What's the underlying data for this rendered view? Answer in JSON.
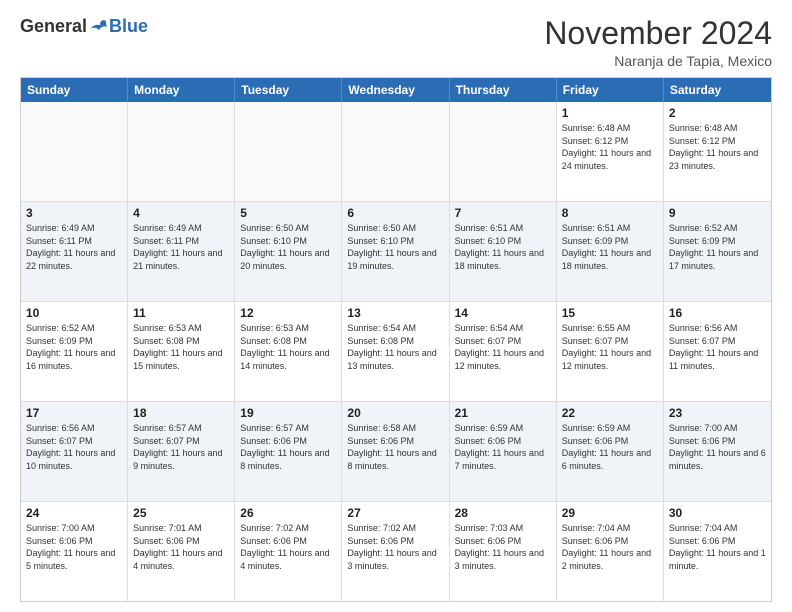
{
  "logo": {
    "general": "General",
    "blue": "Blue"
  },
  "title": "November 2024",
  "location": "Naranja de Tapia, Mexico",
  "header_days": [
    "Sunday",
    "Monday",
    "Tuesday",
    "Wednesday",
    "Thursday",
    "Friday",
    "Saturday"
  ],
  "rows": [
    [
      {
        "day": "",
        "info": "",
        "empty": true
      },
      {
        "day": "",
        "info": "",
        "empty": true
      },
      {
        "day": "",
        "info": "",
        "empty": true
      },
      {
        "day": "",
        "info": "",
        "empty": true
      },
      {
        "day": "",
        "info": "",
        "empty": true
      },
      {
        "day": "1",
        "info": "Sunrise: 6:48 AM\nSunset: 6:12 PM\nDaylight: 11 hours and 24 minutes.",
        "empty": false
      },
      {
        "day": "2",
        "info": "Sunrise: 6:48 AM\nSunset: 6:12 PM\nDaylight: 11 hours and 23 minutes.",
        "empty": false
      }
    ],
    [
      {
        "day": "3",
        "info": "Sunrise: 6:49 AM\nSunset: 6:11 PM\nDaylight: 11 hours and 22 minutes.",
        "empty": false
      },
      {
        "day": "4",
        "info": "Sunrise: 6:49 AM\nSunset: 6:11 PM\nDaylight: 11 hours and 21 minutes.",
        "empty": false
      },
      {
        "day": "5",
        "info": "Sunrise: 6:50 AM\nSunset: 6:10 PM\nDaylight: 11 hours and 20 minutes.",
        "empty": false
      },
      {
        "day": "6",
        "info": "Sunrise: 6:50 AM\nSunset: 6:10 PM\nDaylight: 11 hours and 19 minutes.",
        "empty": false
      },
      {
        "day": "7",
        "info": "Sunrise: 6:51 AM\nSunset: 6:10 PM\nDaylight: 11 hours and 18 minutes.",
        "empty": false
      },
      {
        "day": "8",
        "info": "Sunrise: 6:51 AM\nSunset: 6:09 PM\nDaylight: 11 hours and 18 minutes.",
        "empty": false
      },
      {
        "day": "9",
        "info": "Sunrise: 6:52 AM\nSunset: 6:09 PM\nDaylight: 11 hours and 17 minutes.",
        "empty": false
      }
    ],
    [
      {
        "day": "10",
        "info": "Sunrise: 6:52 AM\nSunset: 6:09 PM\nDaylight: 11 hours and 16 minutes.",
        "empty": false
      },
      {
        "day": "11",
        "info": "Sunrise: 6:53 AM\nSunset: 6:08 PM\nDaylight: 11 hours and 15 minutes.",
        "empty": false
      },
      {
        "day": "12",
        "info": "Sunrise: 6:53 AM\nSunset: 6:08 PM\nDaylight: 11 hours and 14 minutes.",
        "empty": false
      },
      {
        "day": "13",
        "info": "Sunrise: 6:54 AM\nSunset: 6:08 PM\nDaylight: 11 hours and 13 minutes.",
        "empty": false
      },
      {
        "day": "14",
        "info": "Sunrise: 6:54 AM\nSunset: 6:07 PM\nDaylight: 11 hours and 12 minutes.",
        "empty": false
      },
      {
        "day": "15",
        "info": "Sunrise: 6:55 AM\nSunset: 6:07 PM\nDaylight: 11 hours and 12 minutes.",
        "empty": false
      },
      {
        "day": "16",
        "info": "Sunrise: 6:56 AM\nSunset: 6:07 PM\nDaylight: 11 hours and 11 minutes.",
        "empty": false
      }
    ],
    [
      {
        "day": "17",
        "info": "Sunrise: 6:56 AM\nSunset: 6:07 PM\nDaylight: 11 hours and 10 minutes.",
        "empty": false
      },
      {
        "day": "18",
        "info": "Sunrise: 6:57 AM\nSunset: 6:07 PM\nDaylight: 11 hours and 9 minutes.",
        "empty": false
      },
      {
        "day": "19",
        "info": "Sunrise: 6:57 AM\nSunset: 6:06 PM\nDaylight: 11 hours and 8 minutes.",
        "empty": false
      },
      {
        "day": "20",
        "info": "Sunrise: 6:58 AM\nSunset: 6:06 PM\nDaylight: 11 hours and 8 minutes.",
        "empty": false
      },
      {
        "day": "21",
        "info": "Sunrise: 6:59 AM\nSunset: 6:06 PM\nDaylight: 11 hours and 7 minutes.",
        "empty": false
      },
      {
        "day": "22",
        "info": "Sunrise: 6:59 AM\nSunset: 6:06 PM\nDaylight: 11 hours and 6 minutes.",
        "empty": false
      },
      {
        "day": "23",
        "info": "Sunrise: 7:00 AM\nSunset: 6:06 PM\nDaylight: 11 hours and 6 minutes.",
        "empty": false
      }
    ],
    [
      {
        "day": "24",
        "info": "Sunrise: 7:00 AM\nSunset: 6:06 PM\nDaylight: 11 hours and 5 minutes.",
        "empty": false
      },
      {
        "day": "25",
        "info": "Sunrise: 7:01 AM\nSunset: 6:06 PM\nDaylight: 11 hours and 4 minutes.",
        "empty": false
      },
      {
        "day": "26",
        "info": "Sunrise: 7:02 AM\nSunset: 6:06 PM\nDaylight: 11 hours and 4 minutes.",
        "empty": false
      },
      {
        "day": "27",
        "info": "Sunrise: 7:02 AM\nSunset: 6:06 PM\nDaylight: 11 hours and 3 minutes.",
        "empty": false
      },
      {
        "day": "28",
        "info": "Sunrise: 7:03 AM\nSunset: 6:06 PM\nDaylight: 11 hours and 3 minutes.",
        "empty": false
      },
      {
        "day": "29",
        "info": "Sunrise: 7:04 AM\nSunset: 6:06 PM\nDaylight: 11 hours and 2 minutes.",
        "empty": false
      },
      {
        "day": "30",
        "info": "Sunrise: 7:04 AM\nSunset: 6:06 PM\nDaylight: 11 hours and 1 minute.",
        "empty": false
      }
    ]
  ]
}
